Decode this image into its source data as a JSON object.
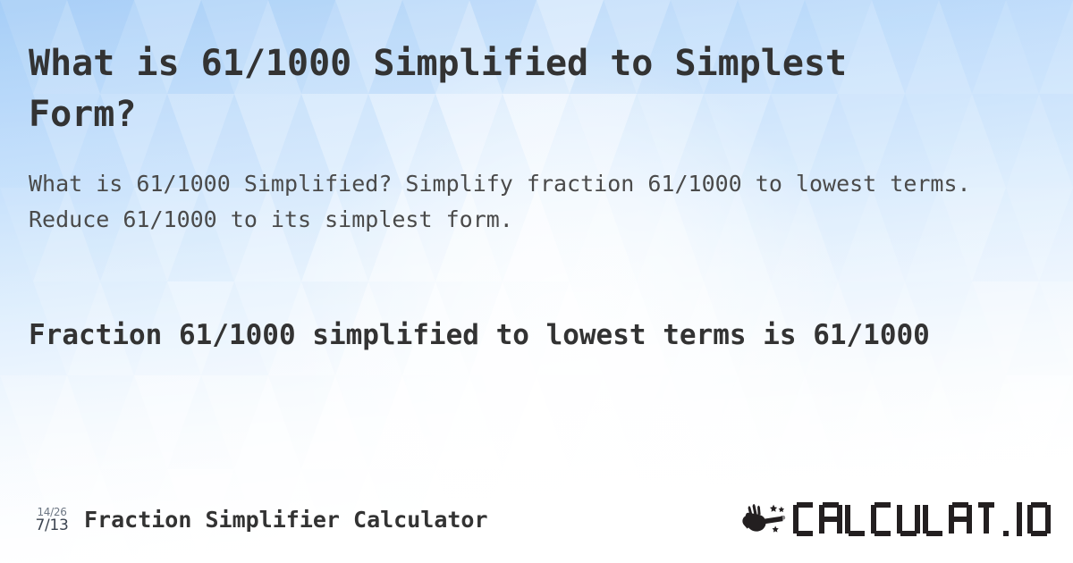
{
  "page": {
    "title": "What is 61/1000 Simplified to Simplest Form?",
    "subtitle": "What is 61/1000 Simplified? Simplify fraction 61/1000 to lowest terms. Reduce 61/1000 to its simplest form.",
    "result": "Fraction 61/1000 simplified to lowest terms is 61/1000"
  },
  "fraction": {
    "numerator": "61",
    "denominator": "1000",
    "original": "61/1000",
    "simplified": "61/1000"
  },
  "footer": {
    "icon_top": "14/26",
    "icon_bottom": "7/13",
    "icon_name": "fraction-simplify-icon",
    "title": "Fraction Simplifier Calculator",
    "logo_text": "CALCULAT.IO",
    "logo_mark_name": "hand-magic-wand-icon"
  },
  "colors": {
    "heading": "#333333",
    "body": "#4a4a4a",
    "logo": "#231f20",
    "background_top": "#a9d0f7",
    "background_bottom": "#ffffff",
    "icon_top": "#6d7784",
    "icon_bottom": "#3b4350"
  }
}
